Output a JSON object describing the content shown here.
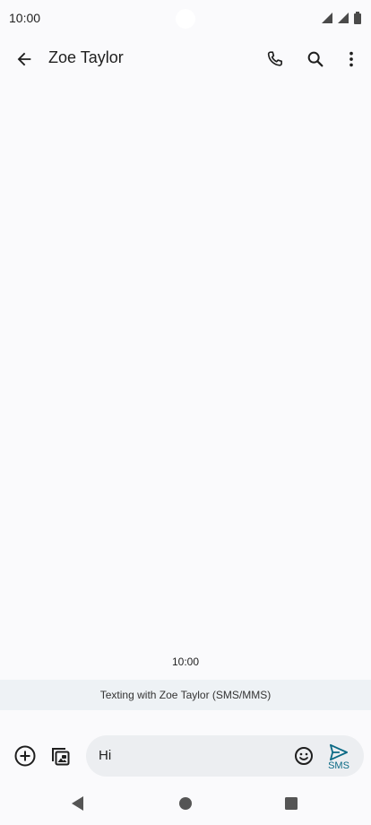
{
  "status_bar": {
    "time": "10:00"
  },
  "app_bar": {
    "contact_name": "Zoe Taylor"
  },
  "conversation": {
    "timestamp": "10:00",
    "texting_banner": "Texting with Zoe Taylor (SMS/MMS)"
  },
  "compose": {
    "input_value": "Hi",
    "send_label": "SMS"
  },
  "colors": {
    "accent": "#0b6a85",
    "background": "#fafafc",
    "banner": "#eef2f5",
    "input_pill": "#eceef1"
  },
  "icons": {
    "back": "arrow-back-icon",
    "call": "phone-icon",
    "search": "search-icon",
    "more": "more-vert-icon",
    "add": "add-circle-icon",
    "gallery": "gallery-icon",
    "emoji": "emoji-icon",
    "send": "send-icon"
  }
}
